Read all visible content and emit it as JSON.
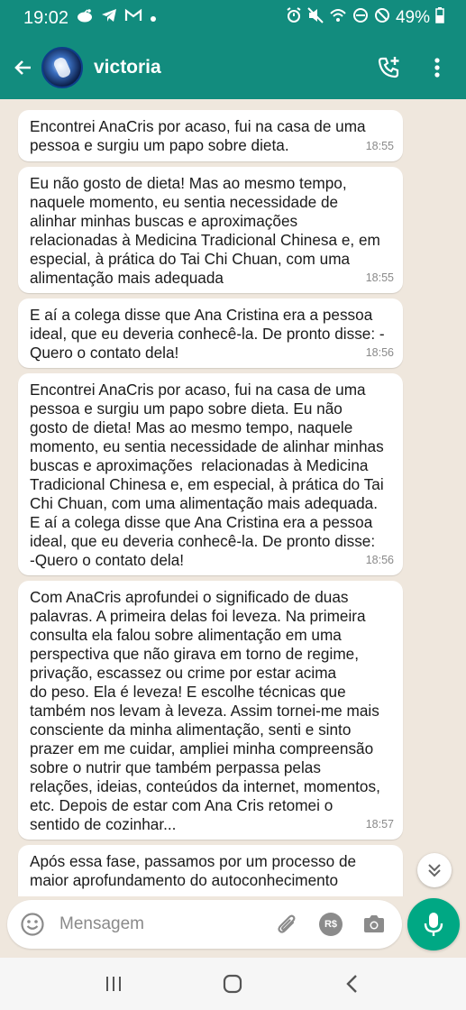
{
  "status": {
    "time": "19:02",
    "battery": "49%",
    "left_icons": [
      "reddit-icon",
      "telegram-icon",
      "gmail-icon",
      "dot-icon"
    ],
    "right_icons": [
      "alarm-icon",
      "mute-icon",
      "wifi-call-icon",
      "no-disturb-icon",
      "blocked-icon",
      "battery-icon"
    ]
  },
  "header": {
    "contact_name": "victoria",
    "color": "#128c7e"
  },
  "messages": [
    {
      "text": "Encontrei AnaCris por acaso, fui na casa de uma\npessoa e surgiu um papo sobre dieta.",
      "time": "18:55"
    },
    {
      "text": "Eu não gosto de dieta! Mas ao mesmo tempo,\nnaquele momento, eu sentia necessidade de\nalinhar minhas buscas e aproximações\nrelacionadas à Medicina Tradicional Chinesa e, em\nespecial, à prática do Tai Chi Chuan, com uma\nalimentação mais adequada",
      "time": "18:55"
    },
    {
      "text": "E aí a colega disse que Ana Cristina era a pessoa\nideal, que eu deveria conhecê-la. De pronto disse: -\nQuero o contato dela!",
      "time": "18:56"
    },
    {
      "text": "Encontrei AnaCris por acaso, fui na casa de uma\npessoa e surgiu um papo sobre dieta. Eu não\ngosto de dieta! Mas ao mesmo tempo, naquele\nmomento, eu sentia necessidade de alinhar minhas\nbuscas e aproximações  relacionadas à Medicina\nTradicional Chinesa e, em especial, à prática do Tai\nChi Chuan, com uma alimentação mais adequada.\nE aí a colega disse que Ana Cristina era a pessoa\nideal, que eu deveria conhecê-la. De pronto disse:\n-Quero o contato dela!",
      "time": "18:56"
    },
    {
      "text": "Com AnaCris aprofundei o significado de duas\npalavras. A primeira delas foi leveza. Na primeira\nconsulta ela falou sobre alimentação em uma\nperspectiva que não girava em torno de regime,\nprivação, escassez ou crime por estar acima\ndo peso. Ela é leveza! E escolhe técnicas que\ntambém nos levam à leveza. Assim tornei-me mais\nconsciente da minha alimentação, senti e sinto\nprazer em me cuidar, ampliei minha compreensão\nsobre o nutrir que também perpassa pelas\nrelações, ideias, conteúdos da internet, momentos,\netc. Depois de estar com Ana Cris retomei o\nsentido de cozinhar...",
      "time": "18:57"
    },
    {
      "text": "Após essa fase, passamos por um processo de\nmaior aprofundamento do autoconhecimento",
      "time": ""
    }
  ],
  "composer": {
    "placeholder": "Mensagem",
    "currency_label": "R$"
  },
  "accent_color": "#00a884"
}
